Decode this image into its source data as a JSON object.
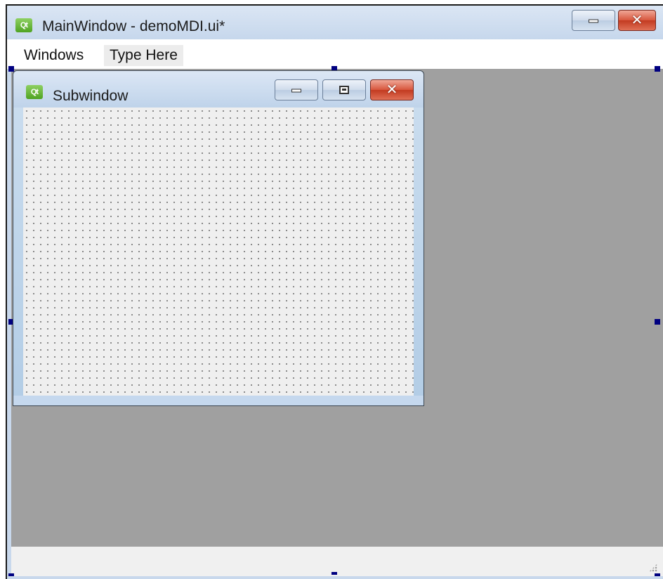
{
  "main_window": {
    "title": "MainWindow - demoMDI.ui*",
    "app_icon": "qt-logo-icon",
    "logo_text": "Qt"
  },
  "menubar": {
    "items": [
      "Windows",
      "Type Here"
    ]
  },
  "subwindow": {
    "title": "Subwindow",
    "app_icon": "qt-logo-icon"
  },
  "colors": {
    "mdi_background": "#a0a0a0",
    "selection_handle": "#000080",
    "close_button": "#c23a20"
  }
}
